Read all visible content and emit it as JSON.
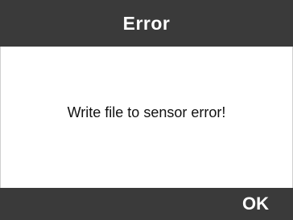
{
  "colors": {
    "bar_background": "#3a3a3a",
    "content_background": "#ffffff",
    "bar_text": "#ffffff",
    "message_text": "#111111"
  },
  "dialog": {
    "title": "Error",
    "message": "Write file to sensor error!",
    "ok_label": "OK"
  }
}
